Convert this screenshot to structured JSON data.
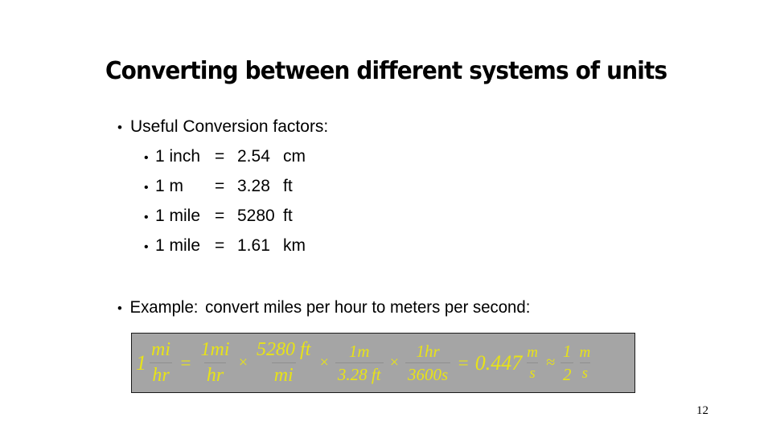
{
  "slide": {
    "title": "Converting between different systems of units",
    "number": "12",
    "background_color": "#ffffff"
  },
  "body": {
    "intro_bullet": "Useful Conversion factors:",
    "bullet_glyph": "•",
    "conversions": [
      {
        "quantity": "1 inch",
        "equals": "=",
        "value": "2.54",
        "unit": "cm"
      },
      {
        "quantity": "1 m",
        "equals": "=",
        "value": "3.28",
        "unit": "ft"
      },
      {
        "quantity": "1 mile",
        "equals": "=",
        "value": "5280",
        "unit": "ft"
      },
      {
        "quantity": "1 mile",
        "equals": "=",
        "value": "1.61",
        "unit": "km"
      }
    ],
    "example_label": "Example:",
    "example_text": "convert miles per hour to meters per second:"
  },
  "equation": {
    "background_color": "#a5a5a5",
    "text_color": "#e8e317",
    "border_color": "#1a1a1a",
    "lead_coefficient": "1",
    "lhs": {
      "numerator": "mi",
      "denominator": "hr"
    },
    "op_equals": "=",
    "factors": [
      {
        "numerator": "1mi",
        "denominator": "hr"
      },
      {
        "numerator": "5280 ft",
        "denominator": "mi"
      },
      {
        "numerator": "1m",
        "denominator": "3.28 ft"
      },
      {
        "numerator": "1hr",
        "denominator": "3600s"
      }
    ],
    "op_multiply": "×",
    "op_result_equals": "=",
    "result_value": "0.447",
    "result_unit": {
      "numerator": "m",
      "denominator": "s"
    },
    "op_approx": "≈",
    "approx_coefficient": {
      "numerator": "1",
      "denominator": "2"
    },
    "approx_unit": {
      "numerator": "m",
      "denominator": "s"
    }
  }
}
